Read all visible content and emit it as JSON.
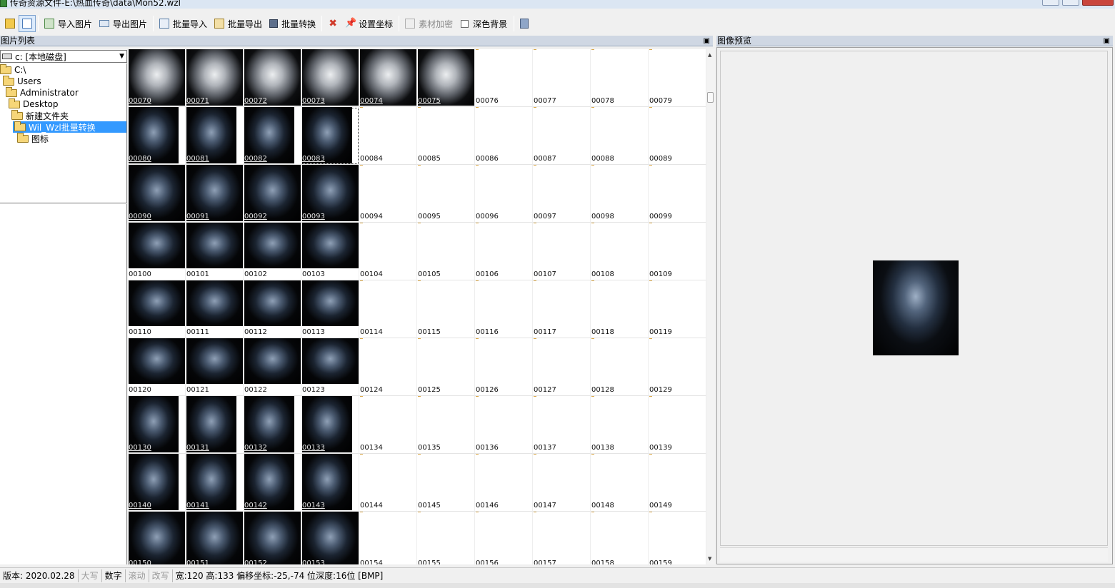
{
  "window": {
    "title": "传奇资源文件-E:\\热血传奇\\data\\Mon52.wzl"
  },
  "toolbar": {
    "import_image": "导入图片",
    "export_image": "导出图片",
    "batch_import": "批量导入",
    "batch_export": "批量导出",
    "batch_convert": "批量转换",
    "set_coords": "设置坐标",
    "encrypt": "素材加密",
    "dark_bg": "深色背景"
  },
  "left_panel": {
    "title": "图片列表",
    "drive": "c: [本地磁盘]",
    "tree": [
      {
        "label": "C:\\"
      },
      {
        "label": "Users"
      },
      {
        "label": "Administrator"
      },
      {
        "label": "Desktop"
      },
      {
        "label": "新建文件夹"
      },
      {
        "label": "Wil_Wzl批量转换",
        "selected": true
      },
      {
        "label": "图标"
      }
    ]
  },
  "preview_panel": {
    "title": "图像预览"
  },
  "grid": {
    "rows": [
      [
        "00070",
        "00071",
        "00072",
        "00073",
        "00074",
        "00075",
        "00076",
        "00077",
        "00078",
        "00079"
      ],
      [
        "00080",
        "00081",
        "00082",
        "00083",
        "00084",
        "00085",
        "00086",
        "00087",
        "00088",
        "00089"
      ],
      [
        "00090",
        "00091",
        "00092",
        "00093",
        "00094",
        "00095",
        "00096",
        "00097",
        "00098",
        "00099"
      ],
      [
        "00100",
        "00101",
        "00102",
        "00103",
        "00104",
        "00105",
        "00106",
        "00107",
        "00108",
        "00109"
      ],
      [
        "00110",
        "00111",
        "00112",
        "00113",
        "00114",
        "00115",
        "00116",
        "00117",
        "00118",
        "00119"
      ],
      [
        "00120",
        "00121",
        "00122",
        "00123",
        "00124",
        "00125",
        "00126",
        "00127",
        "00128",
        "00129"
      ],
      [
        "00130",
        "00131",
        "00132",
        "00133",
        "00134",
        "00135",
        "00136",
        "00137",
        "00138",
        "00139"
      ],
      [
        "00140",
        "00141",
        "00142",
        "00143",
        "00144",
        "00145",
        "00146",
        "00147",
        "00148",
        "00149"
      ],
      [
        "00150",
        "00151",
        "00152",
        "00153",
        "00154",
        "00155",
        "00156",
        "00157",
        "00158",
        "00159"
      ]
    ],
    "image_counts": [
      6,
      4,
      4,
      4,
      4,
      4,
      4,
      4,
      4
    ],
    "selected": "00083"
  },
  "status": {
    "version": "版本: 2020.02.28",
    "caps": "大写",
    "num": "数字",
    "scroll": "滚动",
    "overwrite": "改写",
    "info": "宽:120 高:133 偏移坐标:-25,-74 位深度:16位 [BMP]"
  }
}
